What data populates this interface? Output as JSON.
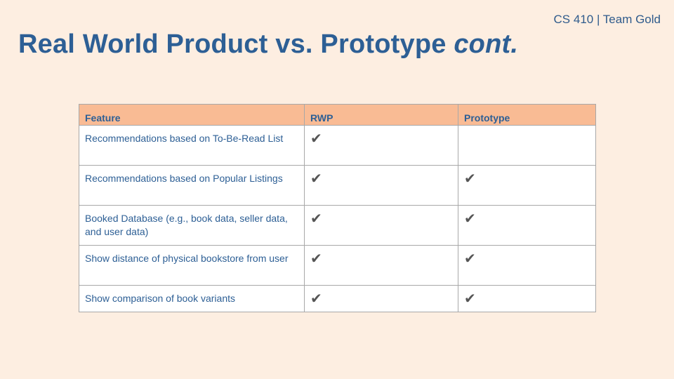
{
  "header": {
    "course_label": "CS 410 | Team Gold",
    "title_main": "Real World Product vs. Prototype ",
    "title_italic": "cont."
  },
  "table": {
    "columns": [
      "Feature",
      "RWP",
      "Prototype"
    ],
    "check_glyph": "✔",
    "check_icon": "checkmark-icon",
    "rows": [
      {
        "feature": "Recommendations based on To-Be-Read List",
        "rwp": true,
        "prototype": false
      },
      {
        "feature": "Recommendations based on Popular Listings",
        "rwp": true,
        "prototype": true
      },
      {
        "feature": "Booked Database (e.g., book data, seller data, and user data)",
        "rwp": true,
        "prototype": true
      },
      {
        "feature": "Show distance of physical bookstore from user",
        "rwp": true,
        "prototype": true
      },
      {
        "feature": "Show comparison of book variants",
        "rwp": true,
        "prototype": true
      }
    ]
  },
  "colors": {
    "background": "#fdeee1",
    "header_fill": "#f9bb94",
    "text_blue": "#2d5f95",
    "check_gray": "#555555"
  }
}
